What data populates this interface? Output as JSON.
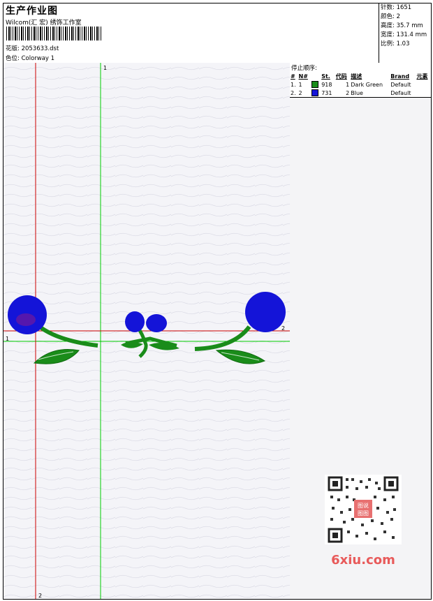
{
  "header": {
    "title": "生产作业图",
    "company": "Wilcom(汇 宏) 绣饰工作室",
    "file_label": "花版:",
    "file_value": "2053633.dst",
    "colorway_label": "色位:",
    "colorway_value": "Colorway 1"
  },
  "specs": {
    "stitches": "针数: 1651",
    "colors": "颜色: 2",
    "height": "高度: 35.7 mm",
    "width": "宽度: 131.4 mm",
    "scale": "比例: 1.03"
  },
  "stop_sequence": {
    "title": "停止顺序:",
    "headers": [
      "#",
      "N#",
      "St.",
      "代码",
      "描述",
      "Brand",
      "元素"
    ],
    "rows": [
      {
        "index": "1.",
        "n": "1",
        "color": "#1a8c1a",
        "st": "918",
        "code": "1",
        "desc": "Dark Green",
        "brand": "Default"
      },
      {
        "index": "2.",
        "n": "2",
        "color": "#1414d8",
        "st": "731",
        "code": "2",
        "desc": "Blue",
        "brand": "Default"
      }
    ]
  },
  "axes": {
    "green_v_top": "1",
    "green_h_left": "1",
    "red_h_right": "2",
    "red_v_bottom": "2"
  },
  "watermark": {
    "site": "6xiu.com",
    "seal": "图 说 图 图"
  },
  "colors": {
    "green_thread": "#1a8c1a",
    "blue_thread": "#1414d8",
    "guide_green": "#00cc00",
    "guide_red": "#cc0000"
  }
}
